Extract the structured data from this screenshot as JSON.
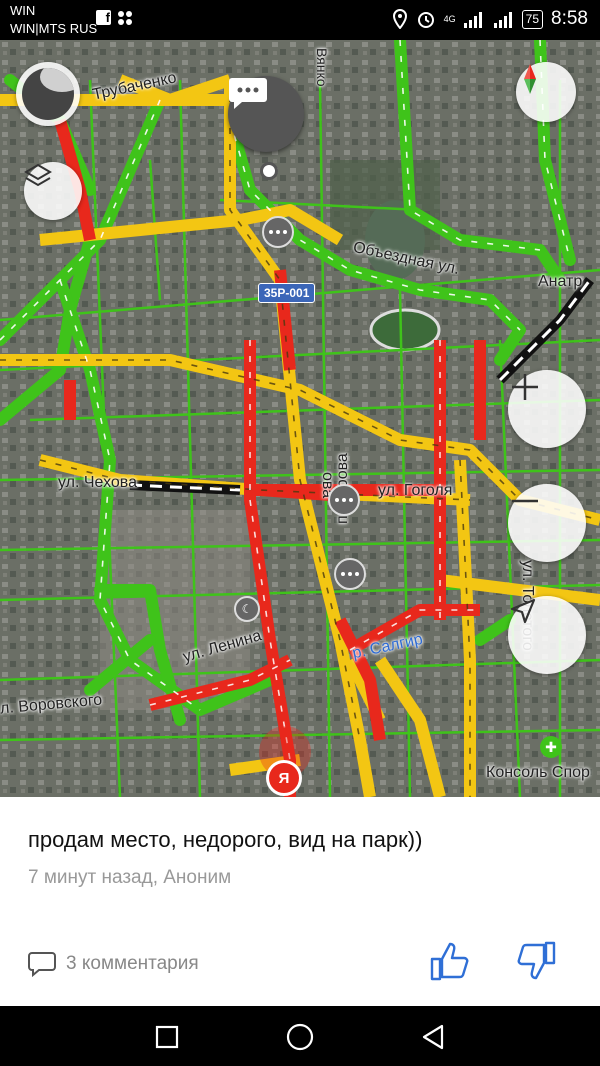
{
  "status": {
    "carrier_line1": "WIN",
    "carrier_line2": "WIN|MTS RUS",
    "network": "4G",
    "battery": "75",
    "time": "8:58"
  },
  "map": {
    "streets": {
      "trubachenko": "Трубаченко",
      "obezdnaya": "Объездная ул.",
      "chekhova": "ул. Чехова",
      "gogolya": "ул. Гоголя",
      "lenina": "ул. Ленина",
      "vorovskogo": "л. Воровского",
      "salgir": "р. Салгир",
      "anatra": "Анатр",
      "kirova": "п. Кирова",
      "kirova2": "ова",
      "tolstogo": "ул. Толстого",
      "konsol": "Консоль Спор",
      "vyazk": "Вянко"
    },
    "road_badge": "35Р-001",
    "user_marker": "Я",
    "colors": {
      "jam_red": "#e8281c",
      "jam_yellow": "#f3c613",
      "free_green": "#3fc31a"
    }
  },
  "controls": {
    "layers_icon": "layers-icon",
    "compass_icon": "compass-icon",
    "zoom_in_icon": "plus-icon",
    "zoom_out_icon": "minus-icon",
    "locate_icon": "navigation-arrow-icon"
  },
  "post": {
    "text": "продам место, недорого, вид на парк))",
    "meta": "7 минут назад, Аноним",
    "comments": "3 комментария"
  }
}
